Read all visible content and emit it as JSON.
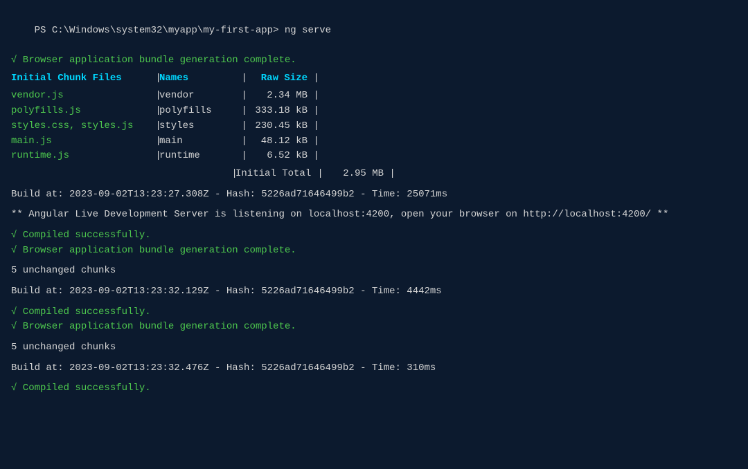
{
  "terminal": {
    "prompt": "PS C:\\Windows\\system32\\myapp\\my-first-app>",
    "command": " ng serve",
    "line_bundle_complete": "√ Browser application bundle generation complete.",
    "table_header": {
      "col_file": "Initial Chunk Files",
      "col_sep1": " | ",
      "col_name": "Names",
      "col_sep2": " | ",
      "col_size": "Raw Size"
    },
    "chunk_files": [
      {
        "file": "vendor.js",
        "name": "vendor",
        "size": "2.34 MB"
      },
      {
        "file": "polyfills.js",
        "name": "polyfills",
        "size": "333.18 kB"
      },
      {
        "file": "styles.css, styles.js",
        "name": "styles",
        "size": "230.45 kB"
      },
      {
        "file": "main.js",
        "name": "main",
        "size": "48.12 kB"
      },
      {
        "file": "runtime.js",
        "name": "runtime",
        "size": "6.52 kB"
      }
    ],
    "initial_total_label": "Initial Total",
    "initial_total_size": "2.95 MB",
    "build_line1": "Build at: 2023-09-02T13:23:27.308Z - Hash: 5226ad71646499b2 - Time: 25071ms",
    "angular_server_line": "** Angular Live Development Server is listening on localhost:4200, open your browser on http://localhost:4200/ **",
    "compiled_successfully": "√ Compiled successfully.",
    "bundle_complete_2": "√ Browser application bundle generation complete.",
    "unchanged_chunks_1": "5 unchanged chunks",
    "build_line2": "Build at: 2023-09-02T13:23:32.129Z - Hash: 5226ad71646499b2 - Time: 4442ms",
    "compiled_successfully_2": "√ Compiled successfully.",
    "bundle_complete_3": "√ Browser application bundle generation complete.",
    "unchanged_chunks_2": "5 unchanged chunks",
    "build_line3": "Build at: 2023-09-02T13:23:32.476Z - Hash: 5226ad71646499b2 - Time: 310ms",
    "compiled_successfully_3": "√ Compiled successfully."
  }
}
